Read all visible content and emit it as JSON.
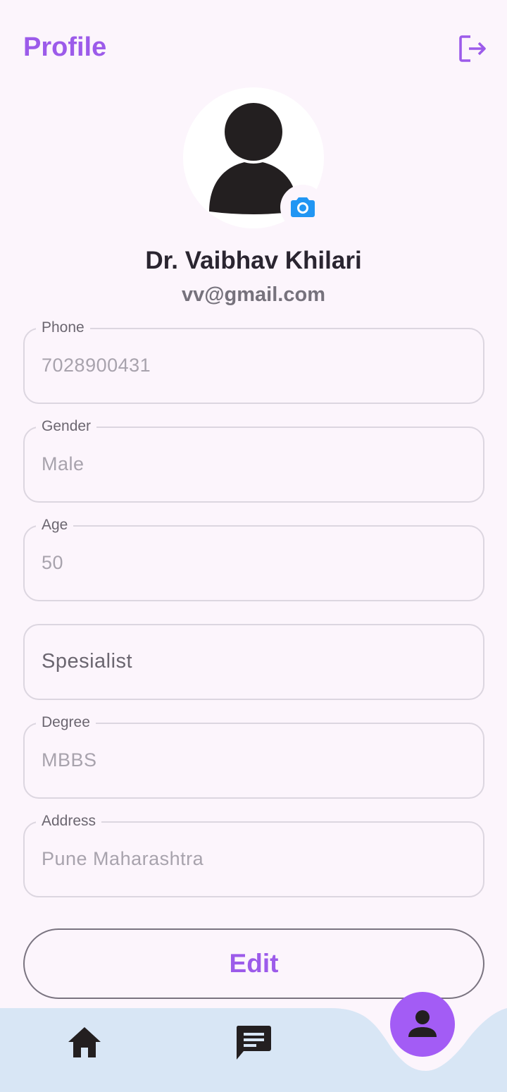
{
  "header": {
    "title": "Profile",
    "logout_icon": "logout-icon"
  },
  "profile": {
    "name": "Dr. Vaibhav Khilari",
    "email": "vv@gmail.com",
    "avatar_icon": "person-icon",
    "camera_icon": "camera-icon"
  },
  "fields": {
    "phone": {
      "label": "Phone",
      "value": "7028900431"
    },
    "gender": {
      "label": "Gender",
      "value": "Male"
    },
    "age": {
      "label": "Age",
      "value": "50"
    },
    "specialist": {
      "placeholder": "Spesialist"
    },
    "degree": {
      "label": "Degree",
      "value": "MBBS"
    },
    "address": {
      "label": "Address",
      "value": "Pune Maharashtra"
    }
  },
  "actions": {
    "edit_label": "Edit"
  },
  "bottom_nav": {
    "items": [
      {
        "icon": "home-icon"
      },
      {
        "icon": "chat-icon"
      },
      {
        "icon": "person-icon",
        "active": true
      }
    ]
  },
  "colors": {
    "accent": "#9c5bea",
    "fab": "#a35cf5",
    "nav_background": "#d8e6f5",
    "page_background": "#fcf5fc",
    "camera": "#2196f3"
  }
}
